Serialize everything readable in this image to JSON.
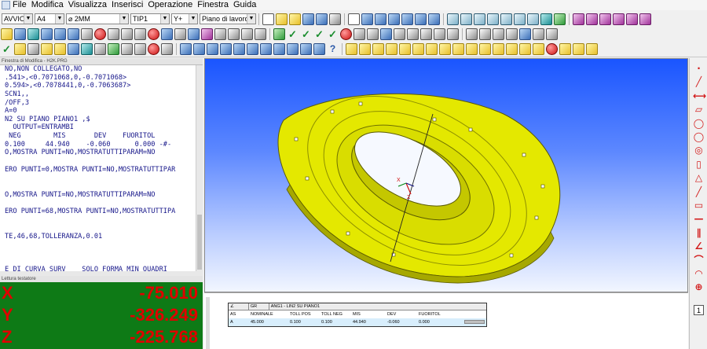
{
  "menu": [
    "File",
    "Modifica",
    "Visualizza",
    "Inserisci",
    "Operazione",
    "Finestra",
    "Guida"
  ],
  "toolbar": {
    "combo_mode": "AVVIO",
    "combo_probe": "A4",
    "combo_tip_dia": "2MM",
    "combo_tip": "TIP1",
    "combo_axis": "Y+",
    "combo_plane": "Piano di lavoro",
    "help_icon": "?"
  },
  "editor": {
    "title": "Finestra di Modifica - H2K.PRG",
    "lines": [
      "NO,NON COLLEGATO,NO",
      ".541>,<0.7071068,0,-0.7071068>",
      "0.594>,<0.7078441,0,-0.7063687>",
      "SCN1,,",
      "/OFF,3",
      "A=0",
      "N2 SU PIANO PIANO1 ,$",
      "  OUTPUT=ENTRAMBI",
      " NEG        MIS       DEV    FUORITOL",
      "0.100     44.940    -0.060      0.000 -#-",
      "O,MOSTRA PUNTI=NO,MOSTRATUTTIPARAM=NO",
      "",
      "ERO PUNTI=0,MOSTRA PUNTI=NO,MOSTRATUTTIPAR",
      "",
      "",
      "O,MOSTRA PUNTI=NO,MOSTRATUTTIPARAM=NO",
      "",
      "ERO PUNTI=68,MOSTRA PUNTI=NO,MOSTRATUTTIPA",
      "",
      "",
      "TE,46,68,TOLLERANZA,0.01",
      "",
      "",
      "",
      "E DI CURVA SURV    SOLO FORMA MIN_QUADRI"
    ]
  },
  "readout": {
    "title": "Lettura testatore",
    "x_label": "X",
    "x_value": "-75.010",
    "y_label": "Y",
    "y_value": "-326.249",
    "z_label": "Z",
    "z_value": "-225.768"
  },
  "report": {
    "header_icon": "angle-icon",
    "header_type": "GR",
    "header_title": "ANG1 - LIN2 SU PIANO1",
    "columns": [
      "AS",
      "NOMINALE",
      "TOLL POS",
      "TOLL NEG",
      "MIS",
      "DEV",
      "FUORITOL"
    ],
    "row": [
      "A",
      "45.000",
      "0.100",
      "0.100",
      "44.940",
      "-0.060",
      "0.000"
    ]
  },
  "right_toolbar": {
    "page_number": "1",
    "icons": [
      "point-icon",
      "line-icon",
      "width-icon",
      "plane-icon",
      "circle-icon",
      "circle-icon",
      "sphere-icon",
      "cylinder-icon",
      "cone-icon",
      "line-icon",
      "flatness-icon",
      "straightness-icon",
      "parallelism-icon",
      "angularity-icon",
      "profile-icon",
      "arc-icon",
      "position-icon"
    ]
  },
  "colors": {
    "part": "#e8ec00",
    "readout_bg": "#0e7a16",
    "readout_text": "#e00000",
    "editor_text": "#17178a"
  }
}
